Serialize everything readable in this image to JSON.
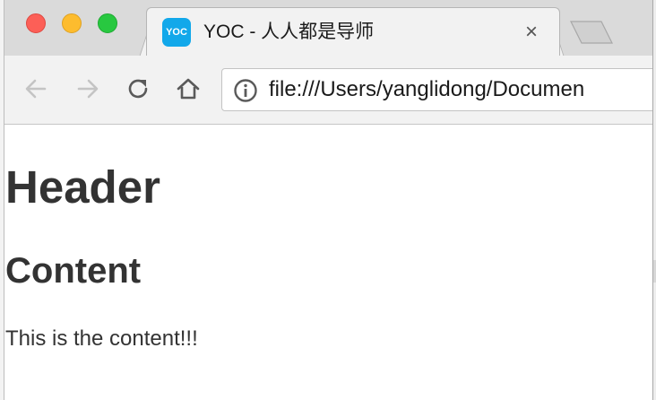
{
  "window": {
    "controls": {
      "close_color": "#fc5f57",
      "minimize_color": "#fdbc2e",
      "maximize_color": "#28c840"
    }
  },
  "tab": {
    "favicon_text": "YOC",
    "favicon_color": "#12a8ea",
    "title": "YOC - 人人都是导师",
    "close_label": "×"
  },
  "toolbar": {
    "back_icon": "arrow-left-icon",
    "forward_icon": "arrow-right-icon",
    "reload_icon": "reload-icon",
    "home_icon": "home-icon",
    "url": "file:///Users/yanglidong/Documen"
  },
  "page": {
    "header": "Header",
    "content_heading": "Content",
    "paragraph": "This is the content!!!"
  }
}
